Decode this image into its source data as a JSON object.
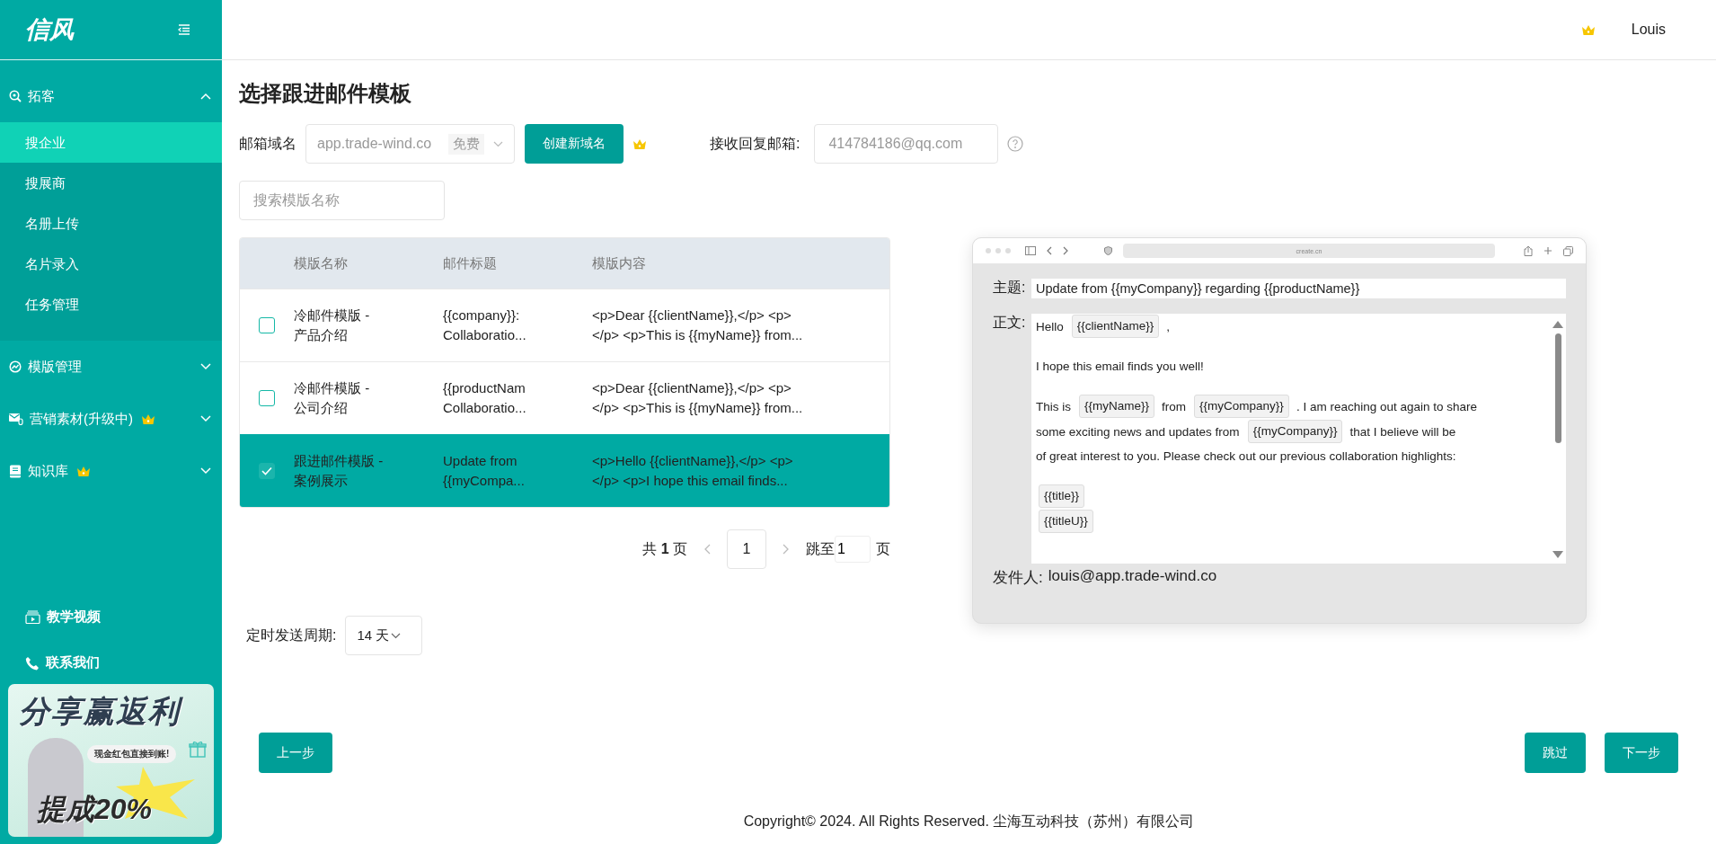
{
  "sidebar": {
    "logo": "信风",
    "groups": [
      {
        "label": "拓客",
        "vip": false,
        "expanded": true,
        "children": [
          {
            "label": "搜企业",
            "selected": true
          },
          {
            "label": "搜展商",
            "selected": false
          },
          {
            "label": "名册上传",
            "selected": false
          },
          {
            "label": "名片录入",
            "selected": false
          },
          {
            "label": "任务管理",
            "selected": false
          }
        ]
      },
      {
        "label": "模版管理",
        "vip": false,
        "expanded": false
      },
      {
        "label": "营销素材(升级中)",
        "vip": true,
        "expanded": false
      },
      {
        "label": "知识库",
        "vip": true,
        "expanded": false
      }
    ],
    "links": [
      {
        "label": "教学视频"
      },
      {
        "label": "联系我们"
      }
    ],
    "banner": {
      "headline": "分享赢返利",
      "tagline": "现金红包直接到账!",
      "offer": "提成20%"
    }
  },
  "header": {
    "user": "Louis",
    "vip": true
  },
  "page": {
    "title": "选择跟进邮件模板",
    "domain": {
      "label": "邮箱域名",
      "value": "app.trade-wind.co",
      "tag": "免费",
      "button": "创建新域名"
    },
    "reply": {
      "label": "接收回复邮箱:",
      "placeholder": "414784186@qq.com"
    },
    "search": {
      "placeholder": "搜索模版名称"
    },
    "table": {
      "columns": [
        "模版名称",
        "邮件标题",
        "模版内容"
      ],
      "rows": [
        {
          "selected": false,
          "cells": [
            "冷邮件模版 -\n产品介绍",
            "{{company}}:\nCollaboratio...",
            "<p>Dear {{clientName}},</p> <p>\n</p> <p>This is {{myName}} from..."
          ]
        },
        {
          "selected": false,
          "cells": [
            "冷邮件模版 -\n公司介绍",
            "{{productNam\nCollaboratio...",
            "<p>Dear {{clientName}},</p> <p>\n</p> <p>This is {{myName}} from..."
          ]
        },
        {
          "selected": true,
          "cells": [
            "跟进邮件模版 -\n案例展示",
            "Update from\n{{myCompa...",
            "<p>Hello {{clientName}},</p> <p>\n</p> <p>I hope this email finds..."
          ]
        }
      ]
    },
    "pagination": {
      "total": "共 **1** 页",
      "current": "1",
      "jump_label": "跳至",
      "jump_value": "1",
      "jump_suffix": "页"
    },
    "schedule": {
      "label": "定时发送周期:",
      "value": "14 天"
    },
    "preview": {
      "url": "create.cn",
      "subject_label": "主题:",
      "subject": "Update from {{myCompany}} regarding {{productName}}",
      "body_label": "正文:",
      "body": [
        [
          [
            {
              "kind": "text",
              "text": "Hello"
            },
            {
              "kind": "tag",
              "text": "{{clientName}}"
            },
            {
              "kind": "text",
              "text": ","
            }
          ]
        ],
        [
          [
            {
              "kind": "text",
              "text": "I hope this email finds you well!"
            }
          ]
        ],
        [
          [
            {
              "kind": "text",
              "text": "This is"
            },
            {
              "kind": "tag",
              "text": "{{myName}}"
            },
            {
              "kind": "text",
              "text": "from"
            },
            {
              "kind": "tag",
              "text": "{{myCompany}}"
            },
            {
              "kind": "text",
              "text": ". I am reaching out again to share"
            }
          ],
          [
            {
              "kind": "text",
              "text": "some exciting news and updates from"
            },
            {
              "kind": "tag",
              "text": "{{myCompany}}"
            },
            {
              "kind": "text",
              "text": "that I believe will be"
            }
          ],
          [
            {
              "kind": "text",
              "text": "of great interest to you. Please check out our previous collaboration highlights:"
            }
          ]
        ],
        [
          [
            {
              "kind": "tag",
              "text": "{{title}}"
            }
          ],
          [
            {
              "kind": "tag",
              "text": "{{titleU}}"
            }
          ]
        ]
      ],
      "sender_label": "发件人:",
      "sender": "louis@app.trade-wind.co"
    },
    "buttons": {
      "back": "上一步",
      "skip": "跳过",
      "next": "下一步"
    },
    "footer": "Copyright© 2024. All Rights Reserved. 尘海互动科技（苏州）有限公司"
  }
}
